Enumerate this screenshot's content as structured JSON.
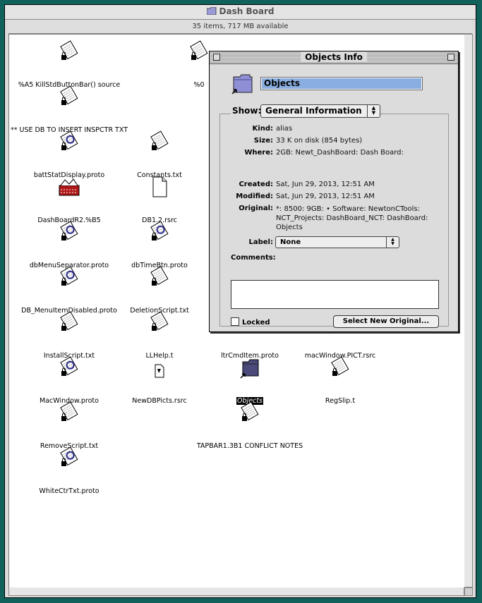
{
  "window": {
    "title": "Dash Board",
    "status": "35 items, 717 MB available"
  },
  "files": [
    {
      "label": "%A5 KillStdButtonBar() source",
      "icon": "clipboard-icon"
    },
    {
      "label": "%0",
      "icon": "clipboard-icon"
    },
    {
      "label": "** USE DB TO INSERT INSPCTR TXT",
      "icon": "clipboard-icon"
    },
    {
      "label": "battStatDisplay.proto",
      "icon": "proto-icon"
    },
    {
      "label": "Constants.txt",
      "icon": "clipboard-icon"
    },
    {
      "label": "DashBoardR2.%B5",
      "icon": "package-icon"
    },
    {
      "label": "DB1.2.rsrc",
      "icon": "document-icon"
    },
    {
      "label": "dbMenuSeparator.proto",
      "icon": "proto-icon"
    },
    {
      "label": "dbTimeBtn.proto",
      "icon": "proto-icon"
    },
    {
      "label": "DB_MenuItemDisabled.proto",
      "icon": "proto-icon"
    },
    {
      "label": "DeletionScript.txt",
      "icon": "clipboard-icon"
    },
    {
      "label": "InstallScript.txt",
      "icon": "clipboard-icon"
    },
    {
      "label": "LLHelp.t",
      "icon": "clipboard-icon"
    },
    {
      "label": "ltrCmdItem.proto",
      "icon": "proto-icon"
    },
    {
      "label": "macWindow.PICT.rsrc",
      "icon": "clipboard-icon"
    },
    {
      "label": "MacWindow.proto",
      "icon": "proto-icon"
    },
    {
      "label": "NewDBPicts.rsrc",
      "icon": "resource-icon"
    },
    {
      "label": "Objects",
      "icon": "folder-alias-icon"
    },
    {
      "label": "RegSlip.t",
      "icon": "clipboard-icon"
    },
    {
      "label": "RemoveScript.txt",
      "icon": "clipboard-icon"
    },
    {
      "label": "TAPBAR1.3B1 CONFLICT NOTES",
      "icon": "clipboard-icon"
    },
    {
      "label": "WhiteCtrTxt.proto",
      "icon": "proto-icon"
    }
  ],
  "info": {
    "title": "Objects Info",
    "name": "Objects",
    "show_label": "Show:",
    "show_value": "General Information",
    "kind_k": "Kind:",
    "kind_v": "alias",
    "size_k": "Size:",
    "size_v": "33 K on disk (854 bytes)",
    "where_k": "Where:",
    "where_v": "2GB: Newt_DashBoard: Dash Board:",
    "created_k": "Created:",
    "created_v": "Sat, Jun 29, 2013, 12:51 AM",
    "modified_k": "Modified:",
    "modified_v": "Sat, Jun 29, 2013, 12:51 AM",
    "original_k": "Original:",
    "original_v": "*: 8500: 9GB: • Software: NewtonCTools: NCT_Projects: DashBoard_NCT: DashBoard: Objects",
    "label_k": "Label:",
    "label_v": "None",
    "comments": "Comments:",
    "locked": "Locked",
    "select_button": "Select New Original..."
  }
}
